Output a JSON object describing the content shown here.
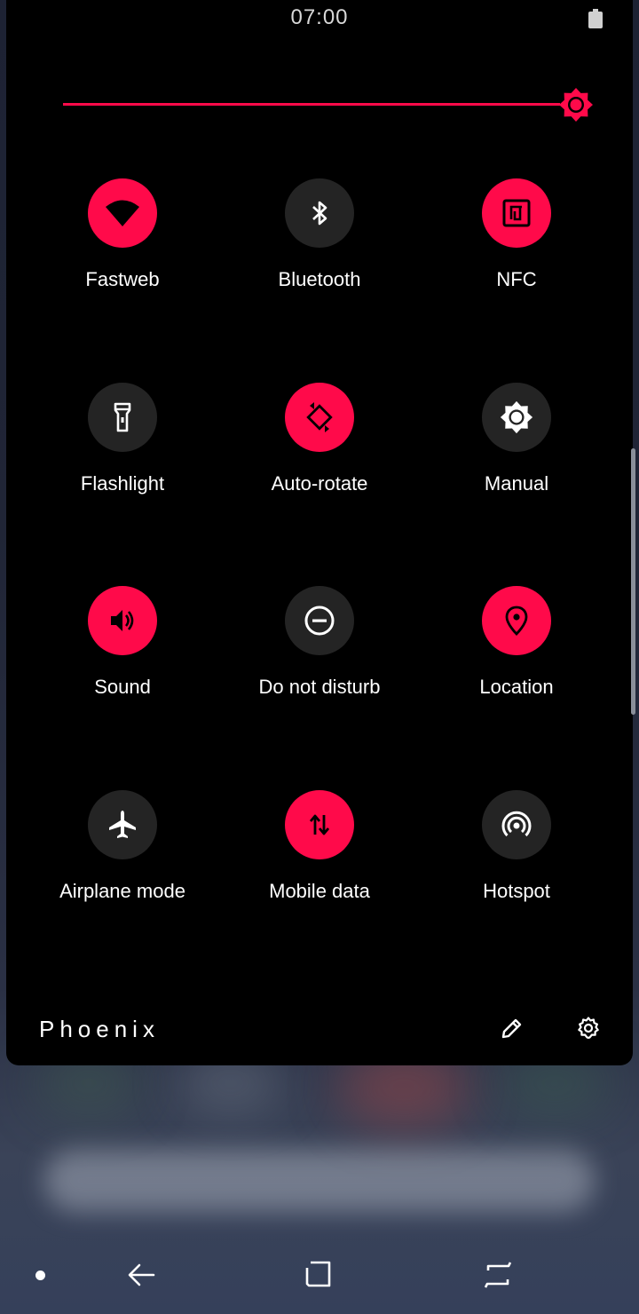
{
  "status_bar": {
    "time": "07:00",
    "battery_icon": "battery-full-icon"
  },
  "brightness": {
    "level": 1.0,
    "icon": "brightness-icon"
  },
  "accent_color": "#ff0a4a",
  "tiles": [
    {
      "label": "Fastweb",
      "icon": "wifi-icon",
      "active": true
    },
    {
      "label": "Bluetooth",
      "icon": "bluetooth-icon",
      "active": false
    },
    {
      "label": "NFC",
      "icon": "nfc-icon",
      "active": true
    },
    {
      "label": "Flashlight",
      "icon": "flashlight-icon",
      "active": false
    },
    {
      "label": "Auto-rotate",
      "icon": "auto-rotate-icon",
      "active": true
    },
    {
      "label": "Manual",
      "icon": "brightness-icon",
      "active": false
    },
    {
      "label": "Sound",
      "icon": "speaker-icon",
      "active": true
    },
    {
      "label": "Do not disturb",
      "icon": "do-not-disturb-icon",
      "active": false
    },
    {
      "label": "Location",
      "icon": "location-pin-icon",
      "active": true
    },
    {
      "label": "Airplane mode",
      "icon": "airplane-icon",
      "active": false
    },
    {
      "label": "Mobile data",
      "icon": "mobile-data-icon",
      "active": true
    },
    {
      "label": "Hotspot",
      "icon": "hotspot-icon",
      "active": false
    }
  ],
  "footer": {
    "brand": "Phoenix",
    "edit_icon": "pencil-icon",
    "settings_icon": "gear-icon"
  },
  "nav_bar": {
    "items": [
      "dot-icon",
      "back-arrow-icon",
      "home-icon",
      "recents-icon"
    ]
  }
}
